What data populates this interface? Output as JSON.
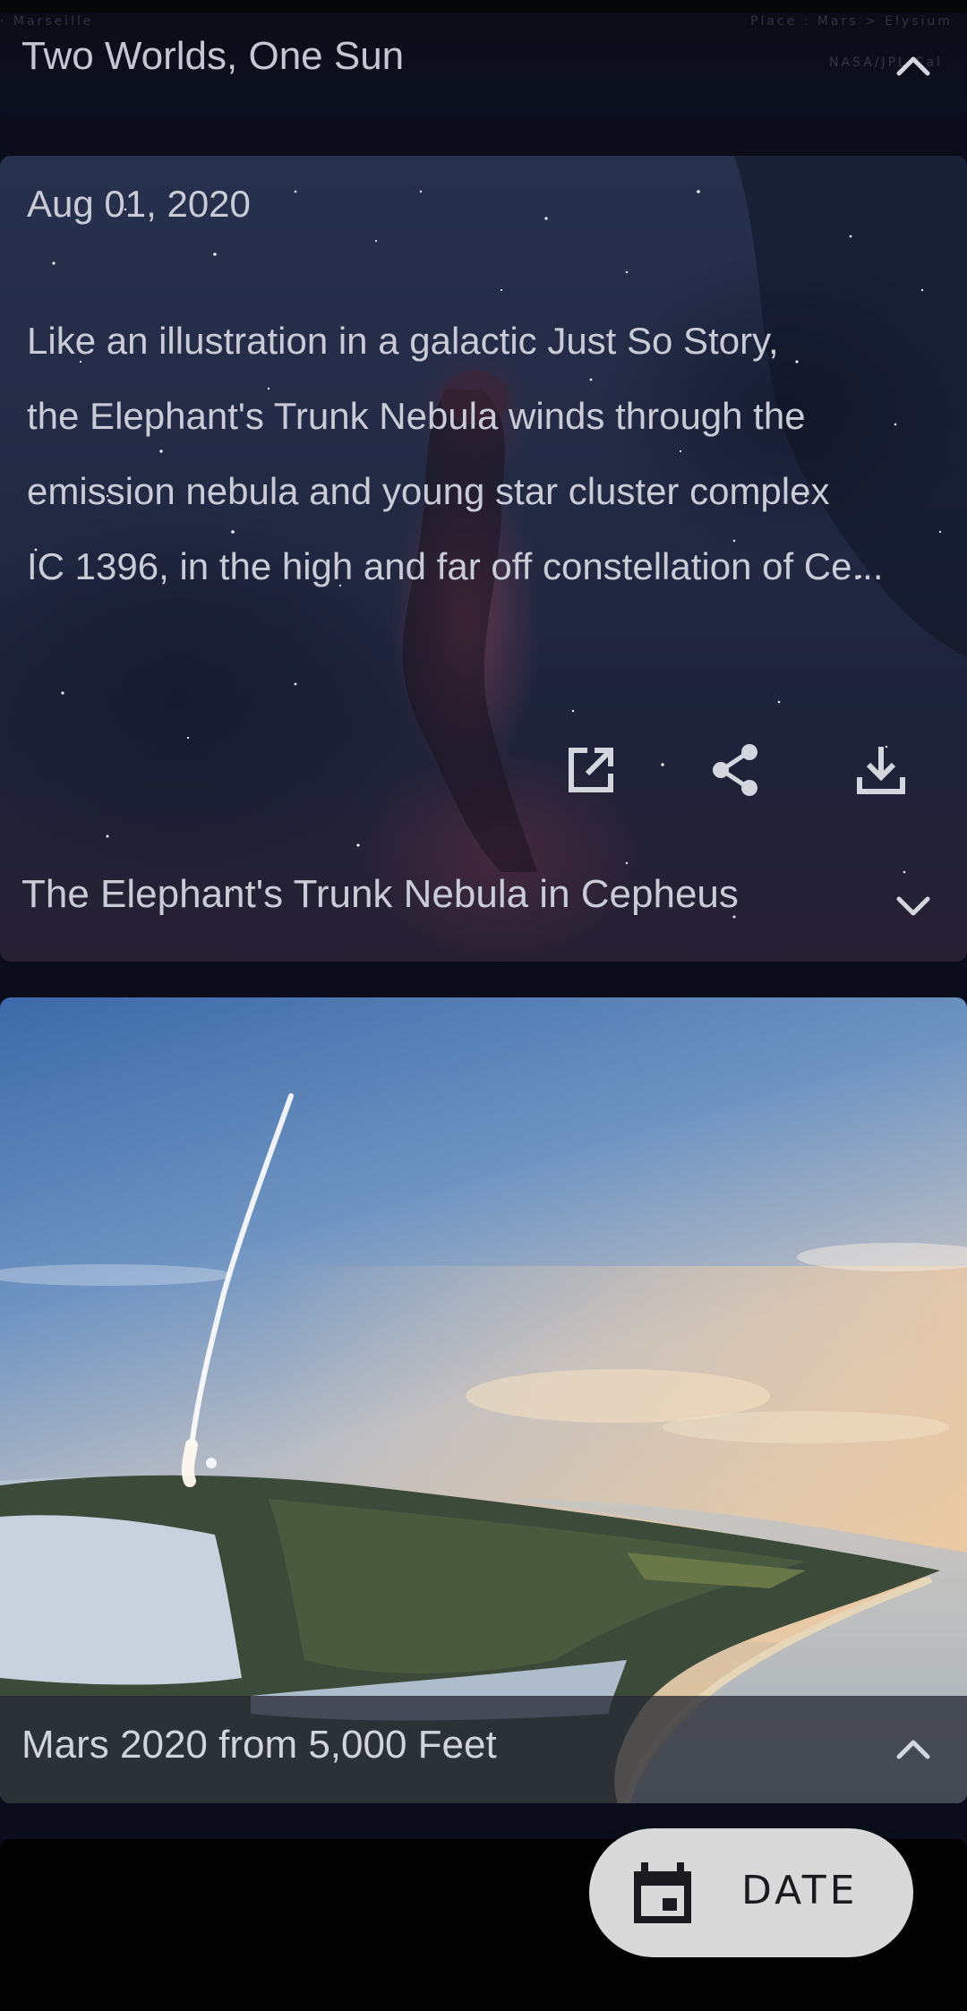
{
  "cards": [
    {
      "title": "Two Worlds, One Sun",
      "expanded": true,
      "background_text": {
        "left": "· Marseille",
        "right_top": "Place : Mars > Elysium",
        "right_bottom": "NASA/JPL-Cal"
      }
    },
    {
      "title": "The Elephant's Trunk Nebula in Cepheus",
      "date": "Aug 01, 2020",
      "description_lines": [
        "Like an illustration in a galactic Just So Story,",
        "the Elephant's Trunk Nebula winds through the",
        "emission nebula and young star cluster complex",
        "IC 1396, in the high and far off constellation of Ce..."
      ],
      "expanded": false,
      "actions": [
        "open-external-icon",
        "share-icon",
        "download-icon"
      ]
    },
    {
      "title": "Mars 2020 from 5,000 Feet",
      "expanded": true
    }
  ],
  "fab": {
    "label": "DATE",
    "icon": "calendar-icon"
  },
  "colors": {
    "background": "#0b0e1a",
    "fab_background": "#d9d9d9",
    "text": "#c9ccd6"
  }
}
